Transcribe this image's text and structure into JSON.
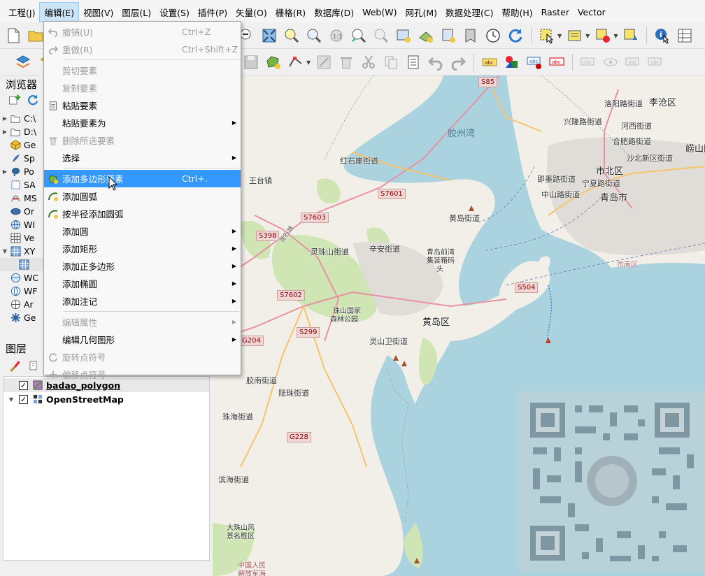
{
  "menubar": [
    {
      "label": "工程(J)"
    },
    {
      "label": "编辑(E)"
    },
    {
      "label": "视图(V)"
    },
    {
      "label": "图层(L)"
    },
    {
      "label": "设置(S)"
    },
    {
      "label": "插件(P)"
    },
    {
      "label": "矢量(O)"
    },
    {
      "label": "栅格(R)"
    },
    {
      "label": "数据库(D)"
    },
    {
      "label": "Web(W)"
    },
    {
      "label": "网孔(M)"
    },
    {
      "label": "数据处理(C)"
    },
    {
      "label": "帮助(H)"
    },
    {
      "label": "Raster"
    },
    {
      "label": "Vector"
    }
  ],
  "browser": {
    "title": "浏览器",
    "items": [
      {
        "label": "C:\\",
        "icon": "folder-icon"
      },
      {
        "label": "D:\\",
        "icon": "folder-icon"
      },
      {
        "label": "Ge",
        "icon": "geopackage-icon"
      },
      {
        "label": "Sp",
        "icon": "spatialite-icon"
      },
      {
        "label": "Po",
        "icon": "postgis-icon"
      },
      {
        "label": "SA",
        "icon": "sap-icon"
      },
      {
        "label": "MS",
        "icon": "mssql-icon"
      },
      {
        "label": "Or",
        "icon": "oracle-icon"
      },
      {
        "label": "WI",
        "icon": "wms-icon"
      },
      {
        "label": "Ve",
        "icon": "vector-tiles-icon"
      },
      {
        "label": "XY",
        "icon": "xyz-tiles-icon"
      },
      {
        "label": "",
        "icon": "tile-layer-icon"
      },
      {
        "label": "WC",
        "icon": "wcs-icon"
      },
      {
        "label": "WF",
        "icon": "wfs-icon"
      },
      {
        "label": "Ar",
        "icon": "arcgis-icon"
      },
      {
        "label": "Ge",
        "icon": "geonode-icon"
      }
    ]
  },
  "layers": {
    "title": "图层",
    "items": [
      {
        "label": "badao_polygon",
        "checked": true
      },
      {
        "label": "OpenStreetMap",
        "checked": true
      }
    ]
  },
  "edit_menu": {
    "items": [
      {
        "label": "撤销(U)",
        "shortcut": "Ctrl+Z",
        "disabled": true,
        "icon": "undo-icon"
      },
      {
        "label": "重做(R)",
        "shortcut": "Ctrl+Shift+Z",
        "disabled": true,
        "icon": "redo-icon"
      },
      {
        "label": "剪切要素",
        "disabled": true
      },
      {
        "label": "复制要素",
        "disabled": true
      },
      {
        "label": "粘贴要素",
        "disabled": false,
        "icon": "paste-icon"
      },
      {
        "label": "粘贴要素为",
        "disabled": false,
        "submenu": true
      },
      {
        "label": "删除所选要素",
        "disabled": true,
        "icon": "delete-icon"
      },
      {
        "label": "选择",
        "disabled": false,
        "submenu": true
      },
      {
        "label": "添加多边形要素",
        "shortcut": "Ctrl+.",
        "highlighted": true,
        "icon": "add-polygon-icon"
      },
      {
        "label": "添加圆弧",
        "icon": "add-arc-icon"
      },
      {
        "label": "按半径添加圆弧",
        "icon": "add-arc-radius-icon"
      },
      {
        "label": "添加圆",
        "submenu": true
      },
      {
        "label": "添加矩形",
        "submenu": true
      },
      {
        "label": "添加正多边形",
        "submenu": true
      },
      {
        "label": "添加椭圆",
        "submenu": true
      },
      {
        "label": "添加注记",
        "submenu": true
      },
      {
        "label": "编辑属性",
        "disabled": true,
        "submenu": true
      },
      {
        "label": "编辑几何图形",
        "submenu": true
      },
      {
        "label": "旋转点符号",
        "disabled": true,
        "icon": "rotate-point-icon"
      },
      {
        "label": "偏移点符号",
        "disabled": true,
        "icon": "offset-point-icon"
      }
    ]
  },
  "map": {
    "labels": {
      "jiaozhou_bay": "胶州湾",
      "luoyang_rd": "洛阳路街道",
      "licang": "李沧区",
      "xinglong_rd": "兴隆路街道",
      "hexi": "河西街道",
      "laoshan": "崂山区",
      "hefei_rd": "合肥路街道",
      "shabei": "沙北新区街道",
      "shibei": "市北区",
      "hongshiya": "红石崖街道",
      "wangtai": "王台镇",
      "jimo_rd": "即墨路街道",
      "ningxia_rd": "宁夏路街道",
      "zhongshan_rd": "中山路街道",
      "qingdao": "青岛市",
      "huangdao_st": "黄岛街道",
      "lingzhu": "灵珠山街道",
      "xinan": "辛安街道",
      "qingdao_port": "青岛前湾",
      "shipping_port": "集装箱码",
      "tou": "头",
      "shinan": "市南区",
      "zhushan": "珠山国家",
      "forest_park": "森林公园",
      "huangdao_dist": "黄岛区",
      "lingshanwei": "灵山卫街道",
      "jiaonan": "胶南街道",
      "yinzhu": "隐珠街道",
      "zhuhai": "珠海街道",
      "binhai": "滨海街道",
      "dazhushan": "大珠山风",
      "scenic": "景名胜区",
      "pla": "中国人民",
      "pla2": "解放军海",
      "hongshi_rd": "青石路"
    },
    "shields": {
      "s85": "S85",
      "s7601": "S7601",
      "s7603": "S7603",
      "s398": "S398",
      "s7602": "S7602",
      "s299": "S299",
      "g204": "G204",
      "g228": "G228",
      "s504": "S504"
    }
  }
}
